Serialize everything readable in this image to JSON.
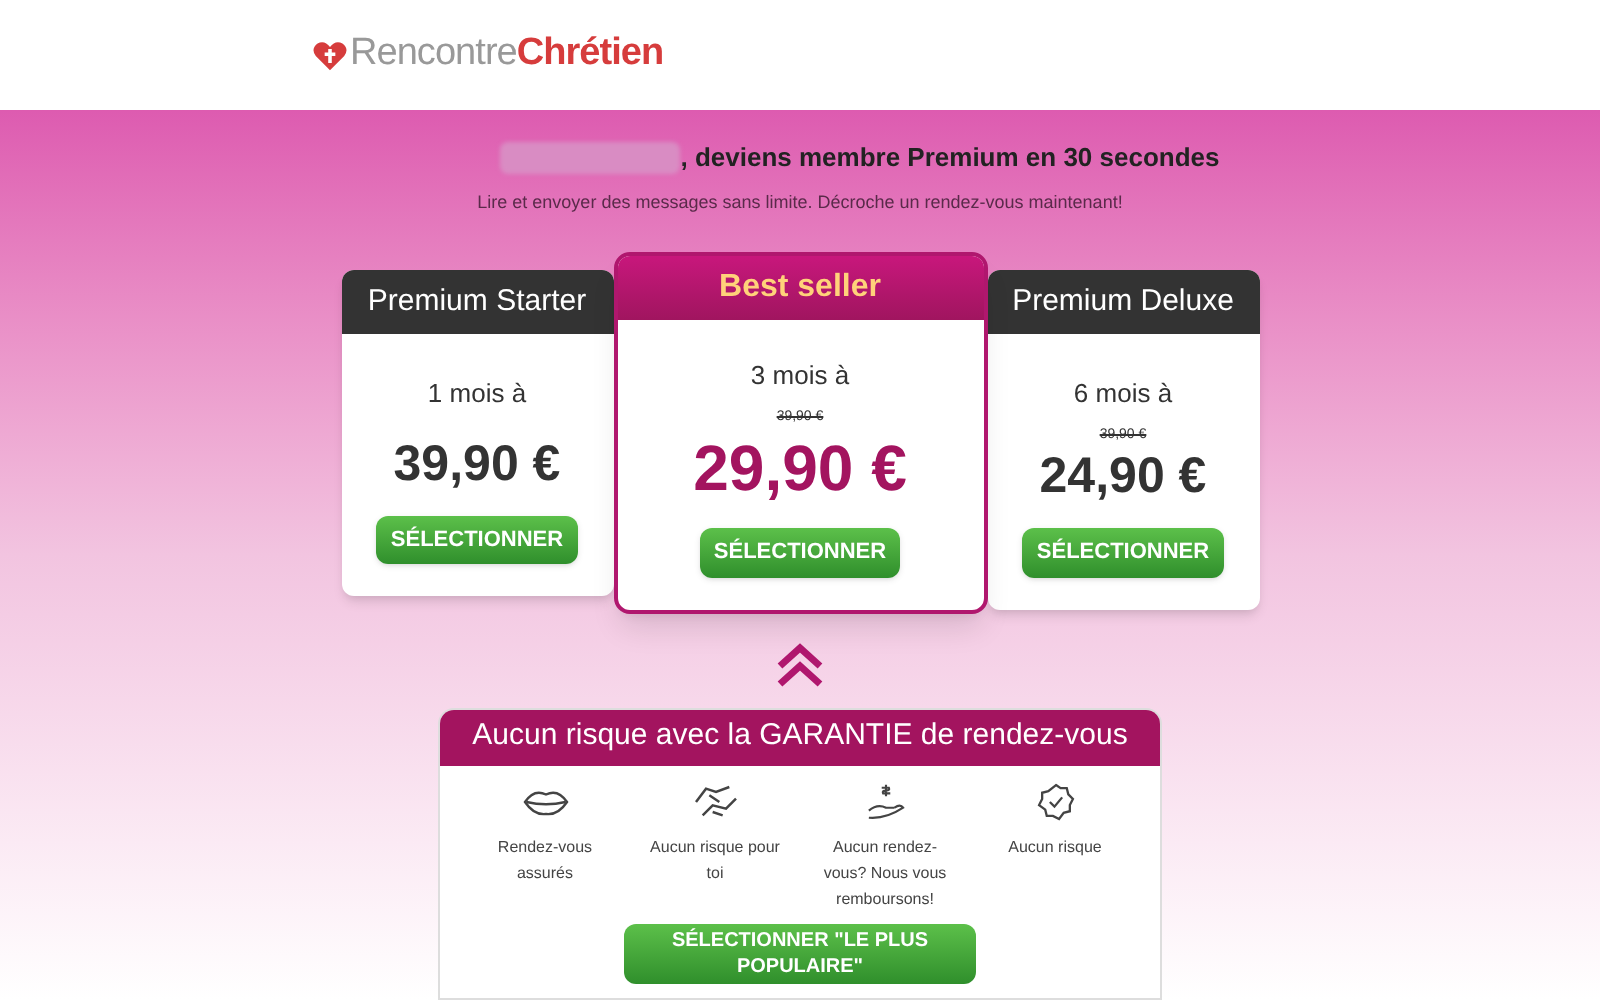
{
  "logo": {
    "part_1": "Rencontre",
    "part_2": "Chrétien"
  },
  "hero": {
    "headline": ", deviens membre Premium en 30 secondes",
    "subtitle": "Lire et envoyer des messages sans limite. Décroche un rendez-vous maintenant!"
  },
  "plans": [
    {
      "header": "Premium Starter",
      "selected": false,
      "duration": "1 mois à",
      "price": "39,90 €",
      "button": "SÉLECTIONNER"
    },
    {
      "header": "Best seller",
      "selected": true,
      "duration": "3 mois à",
      "old_price": "39,90 €",
      "price": "29,90 €",
      "button": "SÉLECTIONNER"
    },
    {
      "header": "Premium Deluxe",
      "selected": false,
      "duration": "6 mois à",
      "old_price": "39,90 €",
      "price": "24,90 €",
      "button": "SÉLECTIONNER"
    }
  ],
  "guarantee": {
    "title": "Aucun risque avec la GARANTIE de rendez-vous",
    "features": [
      {
        "label": "Rendez-vous assurés"
      },
      {
        "label": "Aucun risque pour toi"
      },
      {
        "label": "Aucun rendez-vous? Nous vous remboursons!"
      },
      {
        "label": "Aucun risque"
      }
    ],
    "button": "SÉLECTIONNER \"LE PLUS POPULAIRE\""
  }
}
